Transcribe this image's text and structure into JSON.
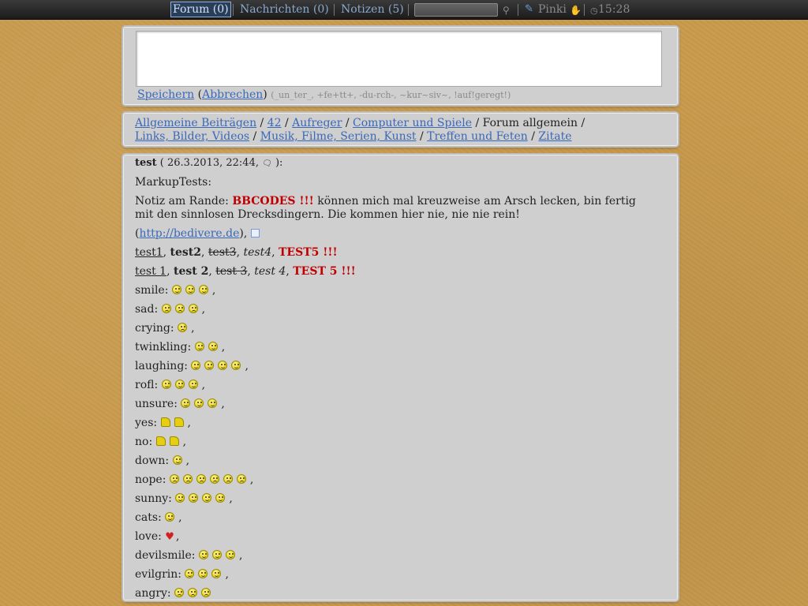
{
  "topbar": {
    "forum": "Forum (0)",
    "messages": "Nachrichten (0)",
    "notes": "Notizen (5)",
    "search_icon": "⚲",
    "tool_icon": "✎",
    "user": "Pinki",
    "hand_icon": "✋",
    "clock_icon": "◷",
    "time": "15:28"
  },
  "editor": {
    "save": "Speichern",
    "cancel_open": " (",
    "cancel": "Abbrechen",
    "cancel_close": ")",
    "hint": "(_un_ter_, +fe+tt+, -du-rch-, ~kur~siv~, !auf!geregt!)"
  },
  "breadcrumb": {
    "items": [
      "Allgemeine Beiträgen",
      "42",
      "Aufreger",
      "Computer und Spiele",
      "Forum allgemein",
      "Links, Bilder, Videos",
      "Musik, Filme, Serien, Kunst",
      "Treffen und Feten",
      "Zitate"
    ]
  },
  "post": {
    "author": "test",
    "meta": " ( 26.3.2013, 22:44, ",
    "meta_icon": "🗨",
    "meta_end": " ):",
    "line1": "MarkupTests:",
    "notice_prefix": "Notiz am Rande: ",
    "notice_red": "BBCODES !!!",
    "notice_rest": " können mich mal kreuzweise am Arsch lecken, bin fertig mit den sinnlosen Drecksdingern. Die kommen hier nie, nie nie rein!",
    "link_open": "(",
    "link": "http://bedivere.de",
    "link_close": "),",
    "t1": "test1",
    "t2": "test2",
    "t3": "test3",
    "t4": "test4",
    "t5": "TEST5 !!!",
    "s1": "test 1",
    "s2": "test 2",
    "s3": "test 3",
    "s4": "test 4",
    "s5": "TEST 5 !!!",
    "smileys": [
      {
        "label": "smile:",
        "count": 3,
        "kind": "happy"
      },
      {
        "label": "sad:",
        "count": 3,
        "kind": "sad"
      },
      {
        "label": "crying:",
        "count": 1,
        "kind": "sad"
      },
      {
        "label": "twinkling:",
        "count": 2,
        "kind": "happy"
      },
      {
        "label": "laughing:",
        "count": 4,
        "kind": "happy"
      },
      {
        "label": "rofl:",
        "count": 3,
        "kind": "happy"
      },
      {
        "label": "unsure:",
        "count": 3,
        "kind": "happy"
      },
      {
        "label": "yes:",
        "count": 2,
        "kind": "thumb"
      },
      {
        "label": "no:",
        "count": 2,
        "kind": "thumb"
      },
      {
        "label": "down:",
        "count": 1,
        "kind": "happy"
      },
      {
        "label": "nope:",
        "count": 6,
        "kind": "sad"
      },
      {
        "label": "sunny:",
        "count": 4,
        "kind": "happy"
      },
      {
        "label": "cats:",
        "count": 1,
        "kind": "happy"
      },
      {
        "label": "love:",
        "count": 1,
        "kind": "heart"
      },
      {
        "label": "devilsmile:",
        "count": 3,
        "kind": "happy"
      },
      {
        "label": "evilgrin:",
        "count": 3,
        "kind": "happy"
      },
      {
        "label": "angry:",
        "count": 3,
        "kind": "sad"
      }
    ]
  }
}
